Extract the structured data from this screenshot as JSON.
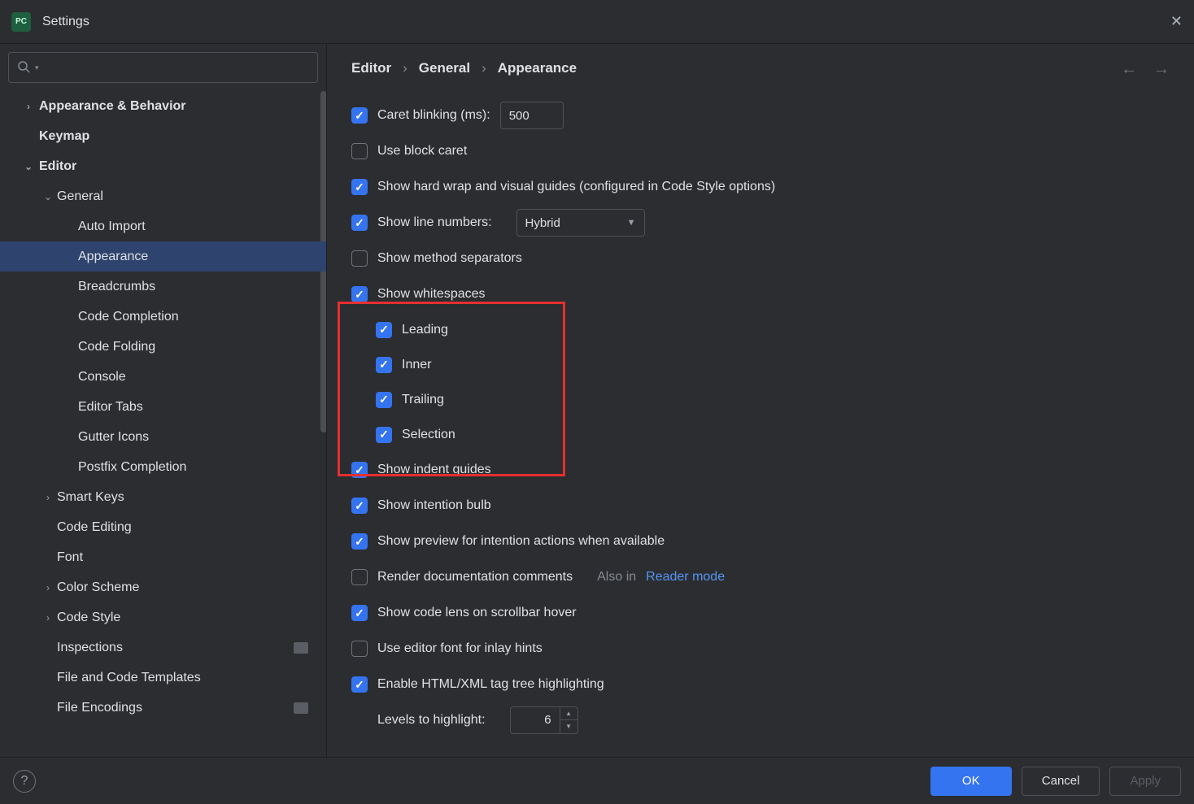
{
  "window": {
    "title": "Settings",
    "app_icon_text": "PC"
  },
  "sidebar": {
    "search_placeholder": "",
    "items": [
      {
        "label": "Appearance & Behavior",
        "depth": 1,
        "chevron": "right",
        "bold": true
      },
      {
        "label": "Keymap",
        "depth": 1,
        "bold": true
      },
      {
        "label": "Editor",
        "depth": 1,
        "chevron": "down",
        "bold": true
      },
      {
        "label": "General",
        "depth": 2,
        "chevron": "down"
      },
      {
        "label": "Auto Import",
        "depth": 3
      },
      {
        "label": "Appearance",
        "depth": 3,
        "selected": true
      },
      {
        "label": "Breadcrumbs",
        "depth": 3
      },
      {
        "label": "Code Completion",
        "depth": 3
      },
      {
        "label": "Code Folding",
        "depth": 3
      },
      {
        "label": "Console",
        "depth": 3
      },
      {
        "label": "Editor Tabs",
        "depth": 3
      },
      {
        "label": "Gutter Icons",
        "depth": 3
      },
      {
        "label": "Postfix Completion",
        "depth": 3
      },
      {
        "label": "Smart Keys",
        "depth": 2,
        "chevron": "right"
      },
      {
        "label": "Code Editing",
        "depth": 2
      },
      {
        "label": "Font",
        "depth": 2
      },
      {
        "label": "Color Scheme",
        "depth": 2,
        "chevron": "right"
      },
      {
        "label": "Code Style",
        "depth": 2,
        "chevron": "right"
      },
      {
        "label": "Inspections",
        "depth": 2,
        "badge": true
      },
      {
        "label": "File and Code Templates",
        "depth": 2
      },
      {
        "label": "File Encodings",
        "depth": 2,
        "badge": true
      }
    ]
  },
  "breadcrumb": [
    "Editor",
    "General",
    "Appearance"
  ],
  "options": {
    "caret_blinking": {
      "label": "Caret blinking (ms):",
      "checked": true,
      "value": "500"
    },
    "use_block_caret": {
      "label": "Use block caret",
      "checked": false
    },
    "hard_wrap": {
      "label": "Show hard wrap and visual guides (configured in Code Style options)",
      "checked": true
    },
    "line_numbers": {
      "label": "Show line numbers:",
      "checked": true,
      "value": "Hybrid"
    },
    "method_separators": {
      "label": "Show method separators",
      "checked": false
    },
    "whitespaces": {
      "label": "Show whitespaces",
      "checked": true,
      "children": [
        {
          "label": "Leading",
          "checked": true
        },
        {
          "label": "Inner",
          "checked": true
        },
        {
          "label": "Trailing",
          "checked": true
        },
        {
          "label": "Selection",
          "checked": true
        }
      ]
    },
    "indent_guides": {
      "label": "Show indent guides",
      "checked": true
    },
    "intention_bulb": {
      "label": "Show intention bulb",
      "checked": true
    },
    "intention_preview": {
      "label": "Show preview for intention actions when available",
      "checked": true
    },
    "render_doc": {
      "label": "Render documentation comments",
      "checked": false,
      "also_in": "Also in",
      "link": "Reader mode"
    },
    "code_lens": {
      "label": "Show code lens on scrollbar hover",
      "checked": true
    },
    "editor_font_inlay": {
      "label": "Use editor font for inlay hints",
      "checked": false
    },
    "html_xml": {
      "label": "Enable HTML/XML tag tree highlighting",
      "checked": true
    },
    "levels": {
      "label": "Levels to highlight:",
      "value": "6"
    }
  },
  "footer": {
    "ok": "OK",
    "cancel": "Cancel",
    "apply": "Apply"
  }
}
